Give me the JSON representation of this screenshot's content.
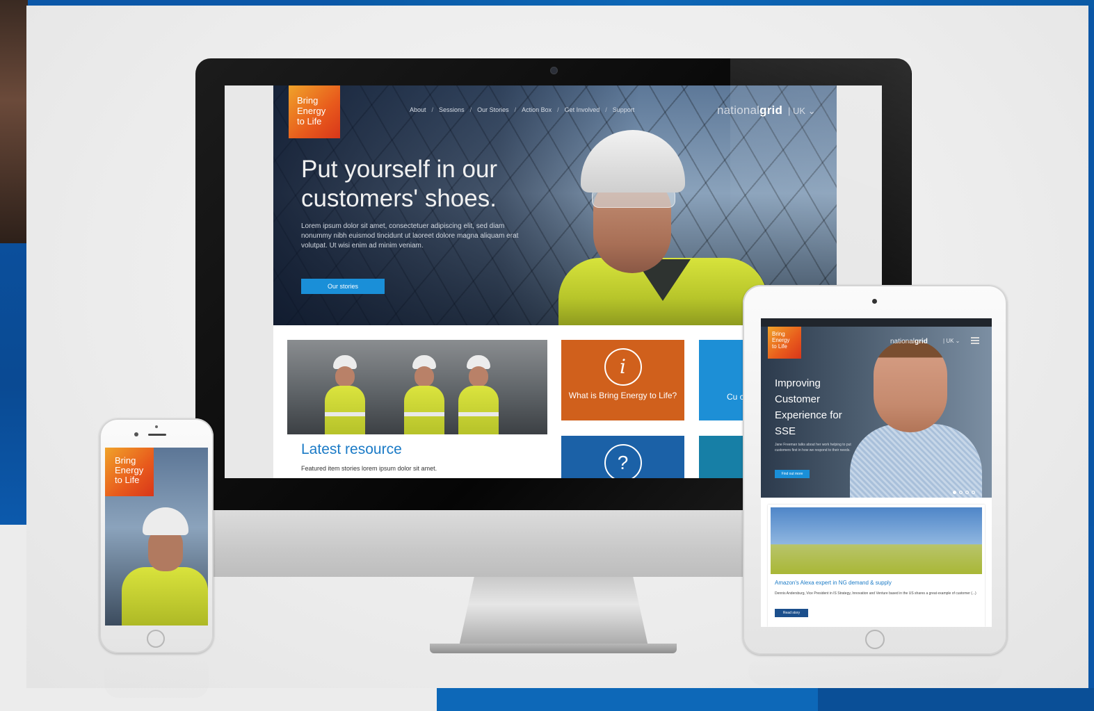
{
  "imac_site": {
    "brand": [
      "Bring",
      "Energy",
      "to Life"
    ],
    "nav": [
      "About",
      "Sessions",
      "Our Stories",
      "Action Box",
      "Get Involved",
      "Support"
    ],
    "logo": {
      "light": "national",
      "bold": "grid"
    },
    "region": "UK",
    "hero": {
      "title": "Put yourself in our customers' shoes.",
      "body": "Lorem ipsum dolor sit amet, consectetuer adipiscing elit, sed diam nonummy nibh euismod tincidunt ut laoreet dolore magna aliquam erat volutpat. Ut wisi enim ad minim veniam.",
      "button": "Our stories"
    },
    "resource": {
      "title": "Latest resource",
      "text": "Featured item stories lorem ipsum dolor sit amet."
    },
    "tiles": [
      {
        "icon": "i",
        "label": "What is Bring Energy to Life?",
        "color": "#d0601c"
      },
      {
        "icon": "",
        "label": "Cu co",
        "color": "#1d8fd6"
      },
      {
        "icon": "?",
        "label": "",
        "color": "#1b61a7"
      },
      {
        "icon": "",
        "label": "",
        "color": "#177fa6"
      }
    ]
  },
  "iphone_site": {
    "brand": [
      "Bring",
      "Energy",
      "to Life"
    ]
  },
  "ipad_site": {
    "brand": [
      "Bring",
      "Energy",
      "to Life"
    ],
    "logo": {
      "light": "national",
      "bold": "grid"
    },
    "region": "UK",
    "hero": {
      "title": [
        "Improving",
        "Customer",
        "Experience for",
        "SSE"
      ],
      "body": "Jane Freeman talks about her work helping to put customers first in how we respond to their needs.",
      "button": "Find out more"
    },
    "card": {
      "title": "Amazon's Alexa expert in NG demand & supply",
      "text": "Dennis Andersburg, Vice President in IS Strategy, Innovation and Venture based in the US shares a great example of customer (...)",
      "button": "Read story"
    }
  },
  "colors": {
    "brand_orange": "#e85a1c",
    "accent_blue": "#1a8fd8",
    "backdrop_blue": "#0b57a8"
  }
}
